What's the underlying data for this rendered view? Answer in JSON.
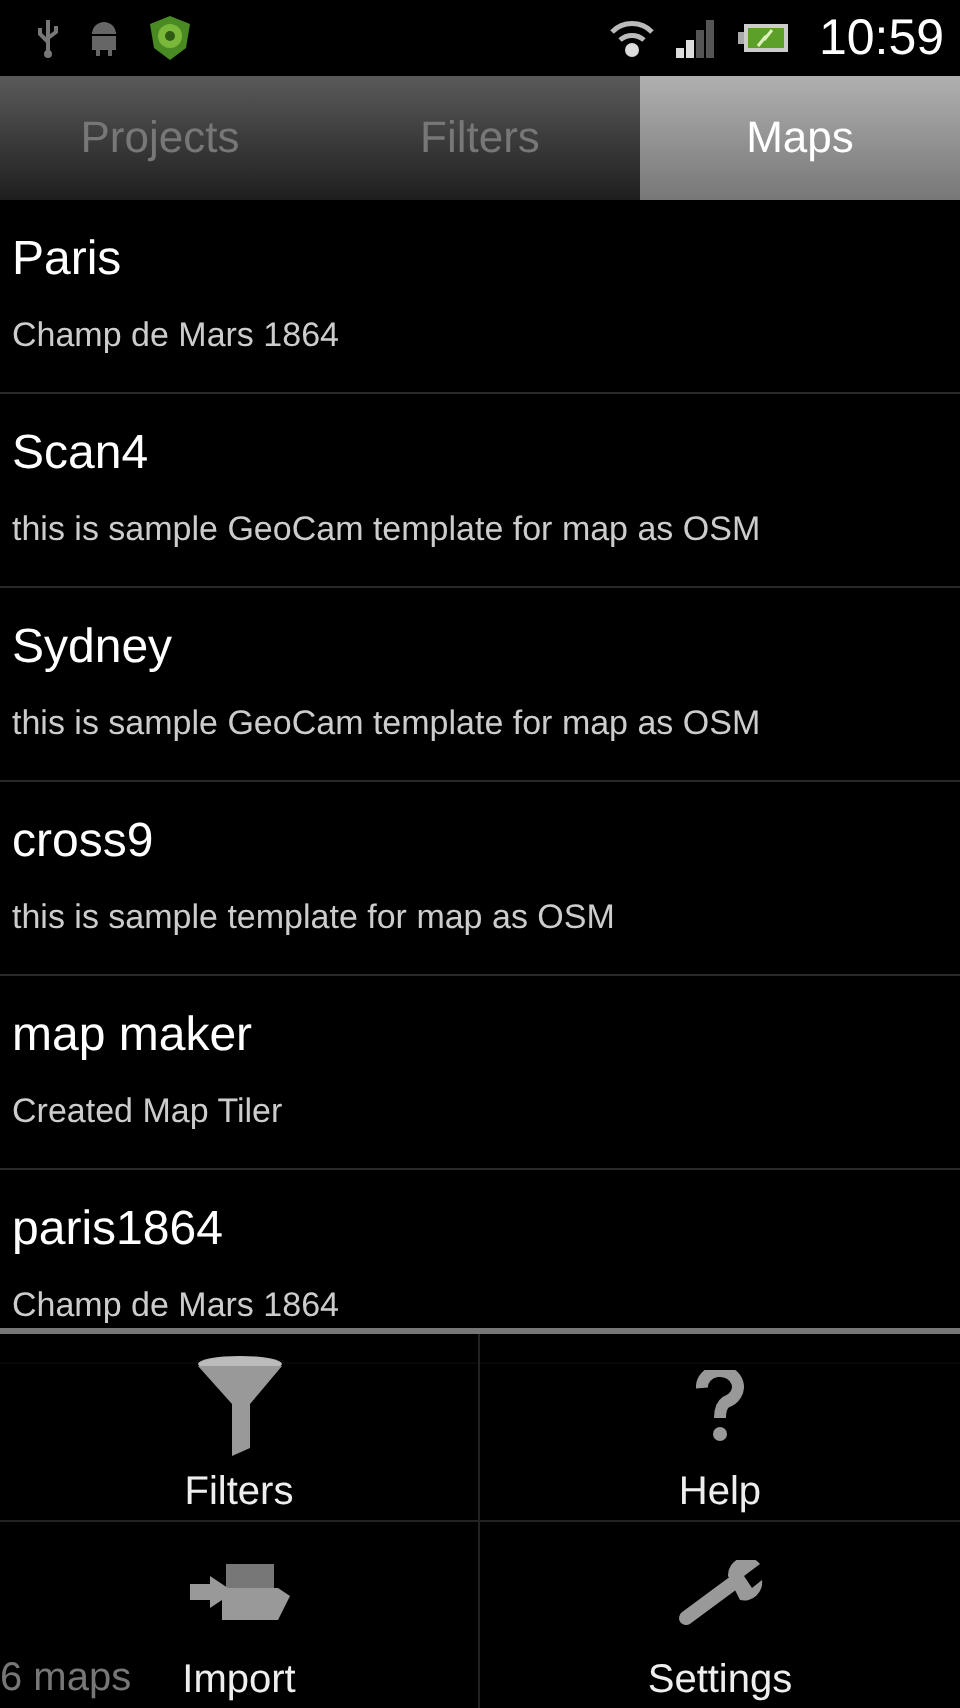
{
  "status_bar": {
    "time": "10:59"
  },
  "tabs": [
    {
      "label": "Projects",
      "selected": false
    },
    {
      "label": "Filters",
      "selected": false
    },
    {
      "label": "Maps",
      "selected": true
    }
  ],
  "maps": [
    {
      "name": "Paris",
      "description": "Champ de Mars 1864"
    },
    {
      "name": "Scan4",
      "description": "this is sample GeoCam template for map as OSM"
    },
    {
      "name": "Sydney",
      "description": "this is sample GeoCam template for map as OSM"
    },
    {
      "name": "cross9",
      "description": "this is sample template for map as OSM"
    },
    {
      "name": "map maker",
      "description": "Created Map Tiler"
    },
    {
      "name": "paris1864",
      "description": "Champ de Mars 1864"
    }
  ],
  "footer": "6 maps",
  "menu": [
    {
      "kind": "filter",
      "label": "Filters"
    },
    {
      "kind": "help",
      "label": "Help"
    },
    {
      "kind": "import",
      "label": "Import"
    },
    {
      "kind": "settings",
      "label": "Settings"
    }
  ]
}
